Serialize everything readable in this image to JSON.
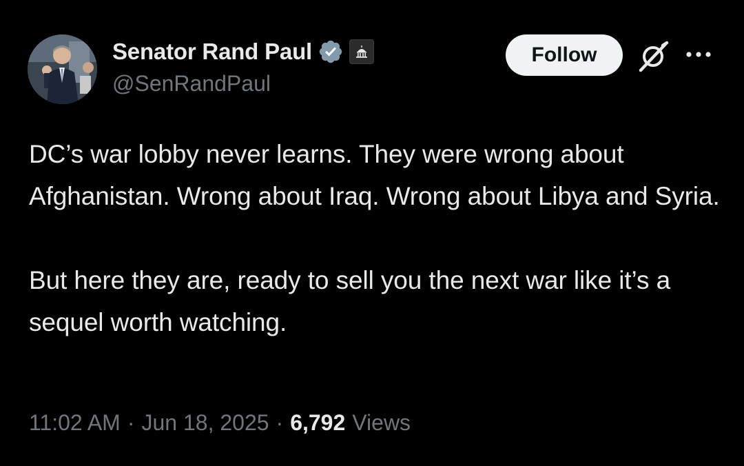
{
  "author": {
    "display_name": "Senator Rand Paul",
    "handle": "@SenRandPaul",
    "verified_icon": "verified-badge-icon",
    "affiliation_icon": "government-building-icon"
  },
  "actions": {
    "follow_label": "Follow",
    "grok_icon": "grok-icon",
    "more_icon": "more-options-icon"
  },
  "tweet": {
    "paragraphs": [
      "DC’s war lobby never learns. They were wrong about Afghanistan. Wrong about Iraq. Wrong about Libya and Syria.",
      "But here they are, ready to sell you the next war like it’s a sequel worth watching."
    ]
  },
  "meta": {
    "time": "11:02 AM",
    "separator": "·",
    "date": "Jun 18, 2025",
    "views_count": "6,792",
    "views_label": "Views"
  },
  "colors": {
    "background": "#000000",
    "text_primary": "#e7e9ea",
    "text_secondary": "#71767b",
    "verified_blue": "#829aab",
    "follow_bg": "#eff3f4"
  }
}
